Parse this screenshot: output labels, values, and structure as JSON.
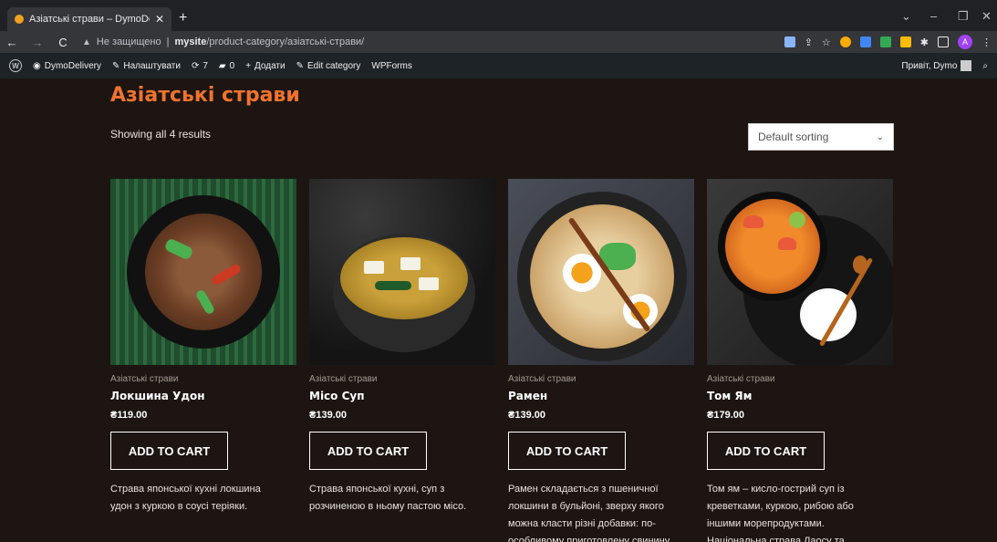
{
  "browser": {
    "tab_title": "Азіатські страви – DymoDelivery",
    "tab_close": "✕",
    "new_tab": "+",
    "url_warning": "Не защищено",
    "url_host": "mysite",
    "url_path": "/product-category/азіатські-страви/",
    "avatar_letter": "A"
  },
  "adminbar": {
    "site": "DymoDelivery",
    "customize": "Налаштувати",
    "updates": "7",
    "comments": "0",
    "new": "Додати",
    "edit_category": "Edit category",
    "wpforms": "WPForms",
    "greeting": "Привіт, Dymo"
  },
  "page": {
    "title": "Азіатські страви",
    "results": "Showing all 4 results",
    "sort_selected": "Default sorting"
  },
  "products": [
    {
      "category": "Азіатські страви",
      "name": "Локшина Удон",
      "price": "₴119.00",
      "button": "ADD TO CART",
      "description": "Страва японської кухні локшина удон з куркою в соусі теріяки."
    },
    {
      "category": "Азіатські страви",
      "name": "Місо Суп",
      "price": "₴139.00",
      "button": "ADD TO CART",
      "description": "Страва японської кухні, суп з розчиненою в ньому пастою місо."
    },
    {
      "category": "Азіатські страви",
      "name": "Рамен",
      "price": "₴139.00",
      "button": "ADD TO CART",
      "description": "Рамен складається з пшеничної локшини в бульйоні, зверху якого можна класти різні добавки: по-особливому приготовлену свинину"
    },
    {
      "category": "Азіатські страви",
      "name": "Том Ям",
      "price": "₴179.00",
      "button": "ADD TO CART",
      "description": "Том ям – кисло-гострий суп із креветками, куркою, рибою або іншими морепродуктами. Національна страва Лаосу та"
    }
  ]
}
